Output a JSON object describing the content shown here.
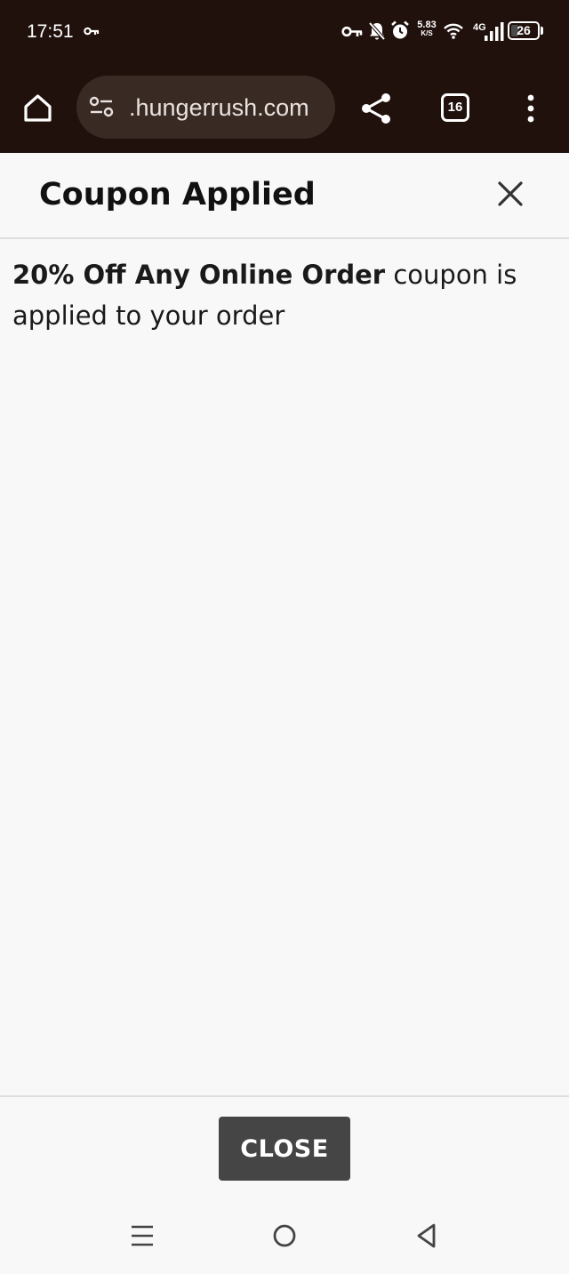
{
  "status_bar": {
    "time": "17:51",
    "network_speed_value": "5.83",
    "network_speed_unit": "K/S",
    "network_type": "4G",
    "battery_level": "26"
  },
  "browser": {
    "url": ".hungerrush.com",
    "tab_count": "16"
  },
  "modal": {
    "title": "Coupon Applied",
    "message_coupon_name": "20% Off Any Online Order",
    "message_suffix": " coupon is applied to your order",
    "close_label": "CLOSE"
  },
  "colors": {
    "top_bar_bg": "#20110d",
    "url_pill_bg": "#3a2a24",
    "modal_bg": "#f8f8f8",
    "close_button_bg": "#454545"
  }
}
